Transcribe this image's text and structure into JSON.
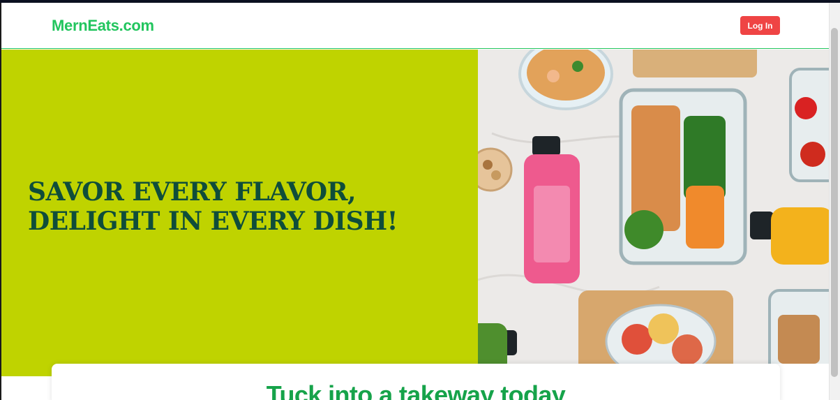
{
  "header": {
    "logo": "MernEats.com",
    "login_label": "Log In"
  },
  "hero": {
    "title_line1": "SAVOR EVERY FLAVOR,",
    "title_line2": "DELIGHT IN EVERY DISH!"
  },
  "search": {
    "title": "Tuck into a takeway today"
  },
  "colors": {
    "brand": "#22c55e",
    "login": "#ef4444",
    "hero_bg": "#bfd300",
    "hero_text": "#0f4d3a"
  }
}
